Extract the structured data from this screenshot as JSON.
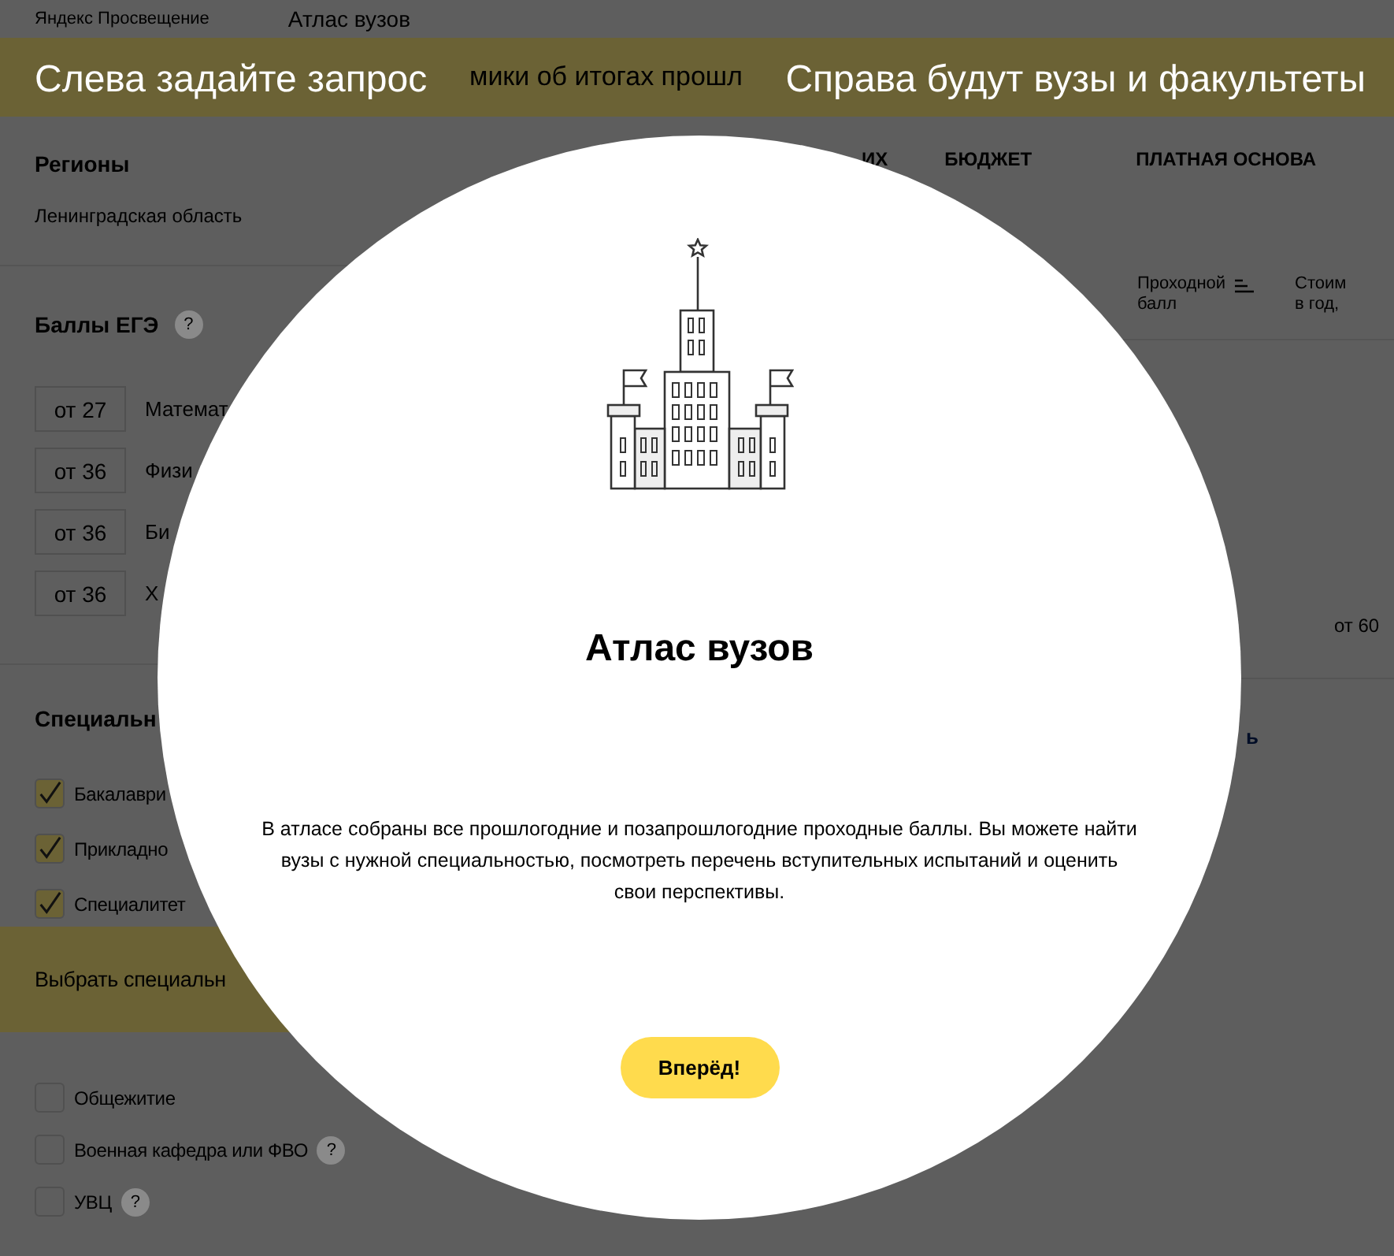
{
  "header": {
    "logo": "Яндекс Просвещение",
    "title": "Атлас вузов"
  },
  "banner": {
    "text": "мики об итогах прошл"
  },
  "hints": {
    "left": "Слева задайте запрос",
    "right": "Справа будут вузы и факультеты"
  },
  "filters": {
    "regions": {
      "title": "Регионы",
      "value": "Ленинградская область"
    },
    "ege": {
      "title": "Баллы ЕГЭ",
      "help": "?",
      "scores": [
        {
          "placeholder": "от 27",
          "subject": "Математ"
        },
        {
          "placeholder": "от 36",
          "subject": "Физи"
        },
        {
          "placeholder": "от 36",
          "subject": "Би"
        },
        {
          "placeholder": "от 36",
          "subject": "Х"
        }
      ]
    },
    "specialties": {
      "title": "Специальн",
      "items": [
        {
          "label": "Бакалаври",
          "checked": true
        },
        {
          "label": "Прикладно",
          "checked": true
        },
        {
          "label": "Специалитет",
          "checked": true
        }
      ]
    },
    "choose_button": "Выбрать специальн",
    "options": [
      {
        "label": "Общежитие",
        "checked": false
      },
      {
        "label": "Военная кафедра или ФВО",
        "checked": false,
        "help": "?"
      },
      {
        "label": "УВЦ",
        "checked": false,
        "help": "?"
      }
    ]
  },
  "results": {
    "tabs": [
      {
        "label": "ИХ"
      },
      {
        "label": "БЮДЖЕТ"
      },
      {
        "label": "ПЛАТНАЯ ОСНОВА"
      }
    ],
    "columns": [
      {
        "lines": [
          "Проходной",
          "балл"
        ],
        "sortable": true
      },
      {
        "lines": [
          "Стоим",
          "в год,"
        ],
        "sortable": false
      }
    ],
    "score": "от 60",
    "link": "ь"
  },
  "modal": {
    "title": "Атлас вузов",
    "text": "В атласе собраны все прошлогодние и позапрошлогодние проходные баллы. Вы можете найти вузы с нужной специальностью, посмотреть перечень вступительных испытаний и оценить свои перспективы.",
    "button": "Вперёд!"
  }
}
